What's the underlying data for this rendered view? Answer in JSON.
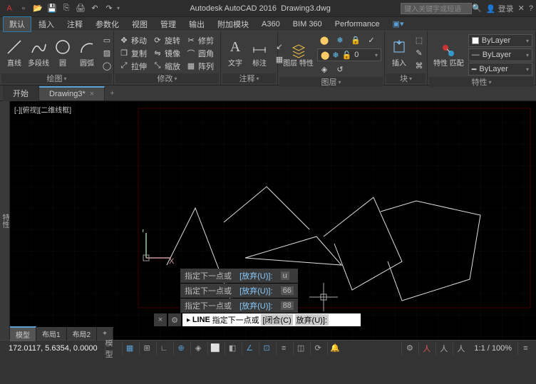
{
  "title": {
    "app": "Autodesk AutoCAD 2016",
    "file": "Drawing3.dwg"
  },
  "search": {
    "placeholder": "键入关键字或短语"
  },
  "login": "登录",
  "menu": {
    "tabs": [
      "默认",
      "插入",
      "注释",
      "参数化",
      "视图",
      "管理",
      "输出",
      "附加模块",
      "A360",
      "BIM 360",
      "Performance"
    ],
    "active": 0
  },
  "ribbon": {
    "draw": {
      "title": "绘图",
      "line": "直线",
      "polyline": "多段线",
      "circle": "圆",
      "arc": "圆弧"
    },
    "modify": {
      "title": "修改",
      "move": "移动",
      "rotate": "旋转",
      "trim": "修剪",
      "copy": "复制",
      "mirror": "镜像",
      "fillet": "圆角",
      "stretch": "拉伸",
      "scale": "缩放",
      "array": "阵列"
    },
    "annot": {
      "title": "注释",
      "text": "文字",
      "dim": "标注"
    },
    "layer": {
      "title": "图层",
      "props": "图层\n特性",
      "current": "0"
    },
    "block": {
      "title": "块",
      "insert": "插入"
    },
    "props": {
      "title": "特性",
      "match": "特性\n匹配",
      "bylayer": "ByLayer"
    }
  },
  "filetabs": {
    "start": "开始",
    "current": "Drawing3*"
  },
  "viewport": "[-][俯视][二维线框]",
  "ucs": {
    "x": "X",
    "y": "Y"
  },
  "history": {
    "prompt": "指定下一点或",
    "undo": "[放弃(U)]:",
    "v1": "u",
    "v2": "66",
    "v3": "88"
  },
  "cmdline": {
    "cmd": "LINE",
    "prompt": "指定下一点或",
    "close": "[闭合(C)",
    "undo": "放弃(U)]:"
  },
  "layouts": {
    "model": "模型",
    "l1": "布局1",
    "l2": "布局2"
  },
  "status": {
    "coords": "172.0117, 5.6354, 0.0000",
    "model": "模型",
    "grid": "▦",
    "zoom": "1:1 / 100%"
  },
  "sidebar_label": "特性"
}
